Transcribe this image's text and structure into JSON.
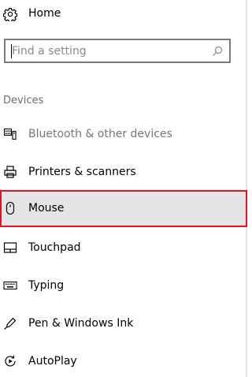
{
  "home": {
    "label": "Home",
    "icon": "gear-icon"
  },
  "search": {
    "placeholder": "Find a setting",
    "value": "",
    "icon": "search-icon"
  },
  "section": {
    "title": "Devices"
  },
  "nav": {
    "items": [
      {
        "label": "Bluetooth & other devices",
        "icon": "bluetooth-devices-icon"
      },
      {
        "label": "Printers & scanners",
        "icon": "printer-icon"
      },
      {
        "label": "Mouse",
        "icon": "mouse-icon"
      },
      {
        "label": "Touchpad",
        "icon": "touchpad-icon"
      },
      {
        "label": "Typing",
        "icon": "keyboard-icon"
      },
      {
        "label": "Pen & Windows Ink",
        "icon": "pen-icon"
      },
      {
        "label": "AutoPlay",
        "icon": "autoplay-icon"
      }
    ]
  },
  "colors": {
    "selection_border": "#e81123",
    "selection_background": "#e5e5e5",
    "muted_text": "#767676"
  }
}
